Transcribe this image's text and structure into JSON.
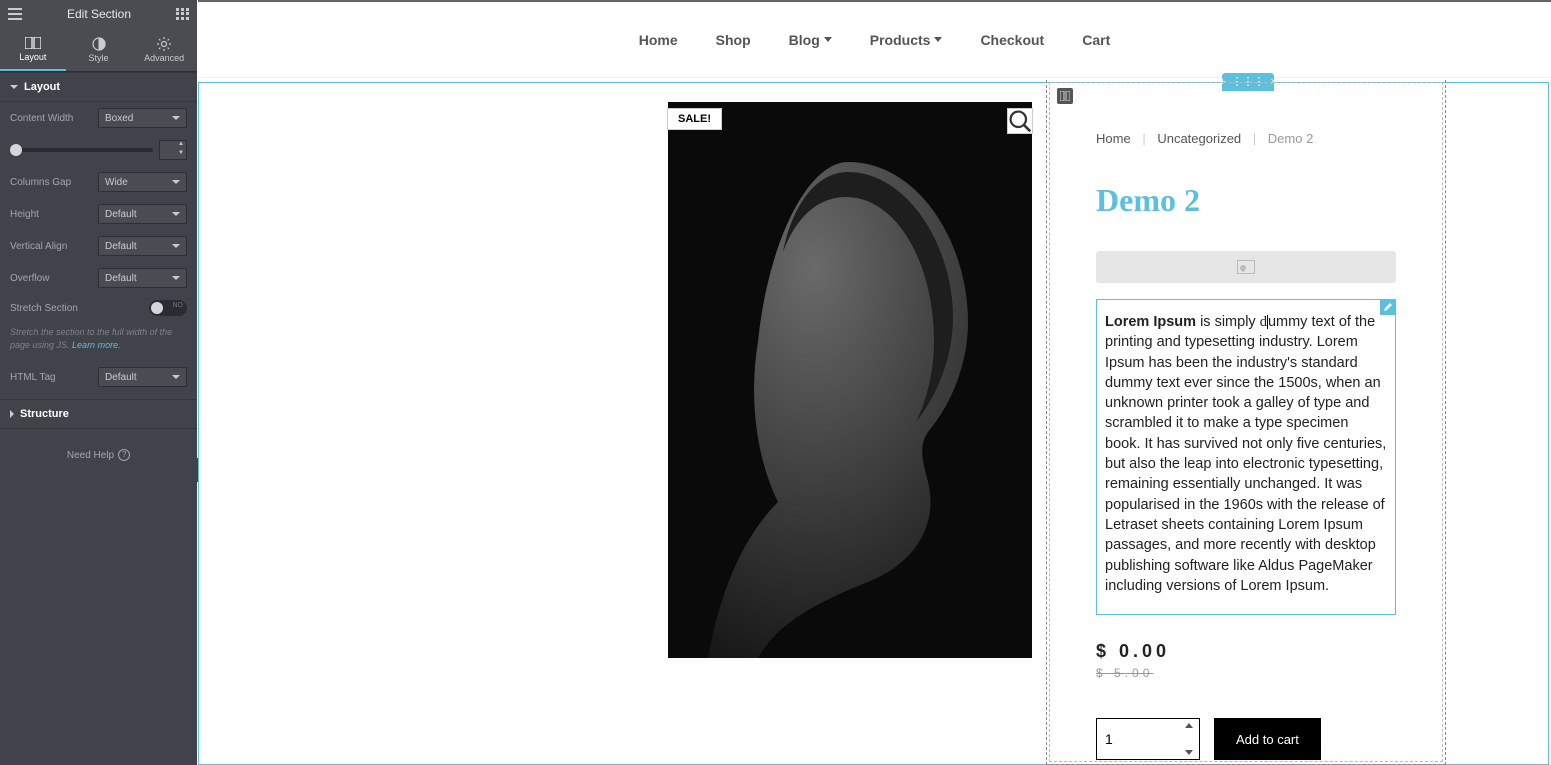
{
  "sidebar": {
    "title": "Edit Section",
    "tabs": {
      "layout": "Layout",
      "style": "Style",
      "advanced": "Advanced"
    },
    "section_layout": "Layout",
    "content_width": {
      "label": "Content Width",
      "value": "Boxed"
    },
    "columns_gap": {
      "label": "Columns Gap",
      "value": "Wide"
    },
    "height": {
      "label": "Height",
      "value": "Default"
    },
    "vertical_align": {
      "label": "Vertical Align",
      "value": "Default"
    },
    "overflow": {
      "label": "Overflow",
      "value": "Default"
    },
    "stretch": {
      "label": "Stretch Section",
      "state": "NO"
    },
    "stretch_hint": {
      "text": "Stretch the section to the full width of the page using JS. ",
      "link": "Learn more."
    },
    "html_tag": {
      "label": "HTML Tag",
      "value": "Default"
    },
    "section_structure": "Structure",
    "need_help": "Need Help"
  },
  "nav": {
    "home": "Home",
    "shop": "Shop",
    "blog": "Blog",
    "products": "Products",
    "checkout": "Checkout",
    "cart": "Cart"
  },
  "product": {
    "sale_badge": "SALE!",
    "breadcrumb": {
      "home": "Home",
      "cat": "Uncategorized",
      "current": "Demo 2"
    },
    "title": "Demo 2",
    "desc_bold": "Lorem Ipsum",
    "desc_pre": " is simply ",
    "desc_mid": "ummy text of the printing and typesetting industry. Lorem Ipsum has been the industry's standard dummy text ever since the 1500s, when an unknown printer took a galley of type and scrambled it to make a type specimen book. It has survived not only five centuries, but also the leap into electronic typesetting, remaining essentially unchanged. It was popularised in the 1960s with the release of Letraset sheets containing Lorem Ipsum passages, and more recently with desktop publishing software like Aldus PageMaker including versions of Lorem Ipsum.",
    "price_now": "$ 0.00",
    "price_old": "$ 5.00",
    "qty": "1",
    "add_to_cart": "Add to cart"
  },
  "section_controls": {
    "add": "+",
    "handle": "⋮⋮⋮",
    "close": "×"
  }
}
